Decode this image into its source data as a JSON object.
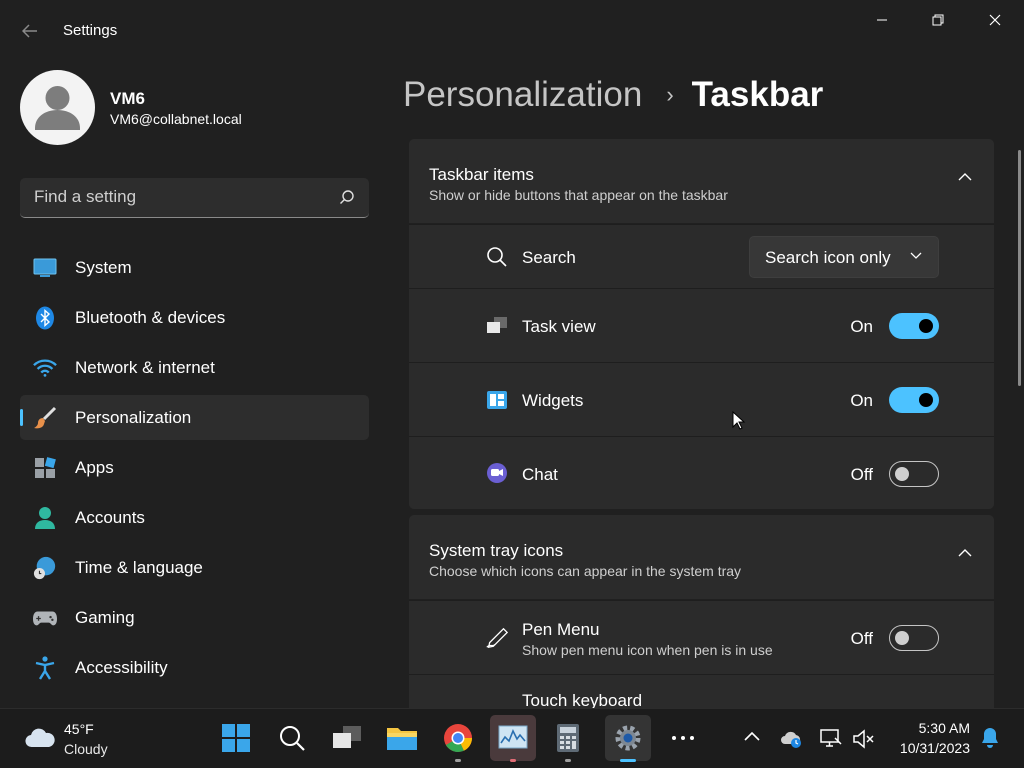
{
  "window": {
    "title": "Settings"
  },
  "profile": {
    "name": "VM6",
    "email": "VM6@collabnet.local"
  },
  "search": {
    "placeholder": "Find a setting"
  },
  "sidebar": {
    "items": [
      {
        "label": "System",
        "icon": "system-icon"
      },
      {
        "label": "Bluetooth & devices",
        "icon": "bluetooth-icon"
      },
      {
        "label": "Network & internet",
        "icon": "wifi-icon"
      },
      {
        "label": "Personalization",
        "icon": "brush-icon",
        "active": true
      },
      {
        "label": "Apps",
        "icon": "apps-icon"
      },
      {
        "label": "Accounts",
        "icon": "accounts-icon"
      },
      {
        "label": "Time & language",
        "icon": "globe-clock-icon"
      },
      {
        "label": "Gaming",
        "icon": "gamepad-icon"
      },
      {
        "label": "Accessibility",
        "icon": "accessibility-icon"
      }
    ]
  },
  "header": {
    "parent": "Personalization",
    "separator": "›",
    "current": "Taskbar"
  },
  "taskbar_items": {
    "title": "Taskbar items",
    "subtitle": "Show or hide buttons that appear on the taskbar",
    "rows": [
      {
        "label": "Search",
        "control": "dropdown",
        "value": "Search icon only",
        "icon": "search-icon"
      },
      {
        "label": "Task view",
        "control": "toggle",
        "state": "On",
        "icon": "task-view-icon"
      },
      {
        "label": "Widgets",
        "control": "toggle",
        "state": "On",
        "icon": "widgets-icon"
      },
      {
        "label": "Chat",
        "control": "toggle",
        "state": "Off",
        "icon": "chat-icon"
      }
    ]
  },
  "system_tray": {
    "title": "System tray icons",
    "subtitle": "Choose which icons can appear in the system tray",
    "rows": [
      {
        "label": "Pen Menu",
        "sub": "Show pen menu icon when pen is in use",
        "state": "Off",
        "icon": "pen-icon"
      },
      {
        "label": "Touch keyboard"
      }
    ]
  },
  "weather": {
    "temp": "45°F",
    "condition": "Cloudy",
    "icon": "cloud-icon"
  },
  "clock": {
    "time": "5:30 AM",
    "date": "10/31/2023"
  },
  "colors": {
    "accent": "#4cc2ff",
    "background": "#202020",
    "card": "#2b2b2b"
  }
}
